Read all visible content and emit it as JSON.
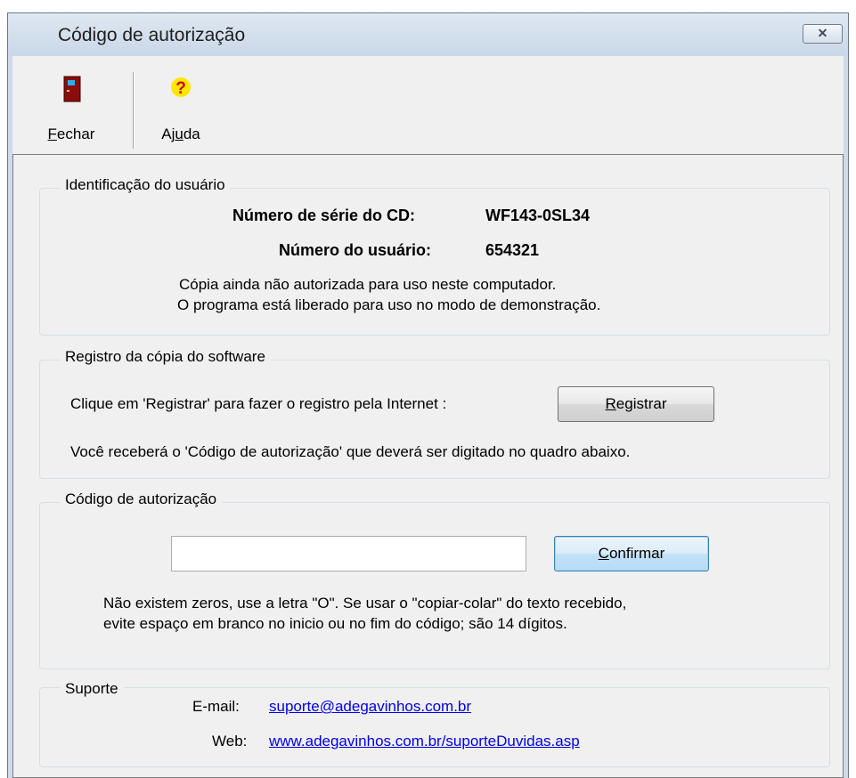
{
  "window": {
    "title": "Código de autorização",
    "close_glyph": "✕"
  },
  "toolbar": {
    "fechar": {
      "label_first": "F",
      "label_rest": "echar",
      "icon": "door-icon"
    },
    "ajuda": {
      "label_first": "Aj",
      "label_mid": "u",
      "label_rest": "da",
      "icon": "help-icon"
    }
  },
  "identificacao": {
    "legend": "Identificação do usuário",
    "serial_label": "Número de série do CD:",
    "serial_value": "WF143-0SL34",
    "user_label": "Número do usuário:",
    "user_value": "654321",
    "status_line1": "Cópia ainda não autorizada para uso neste computador.",
    "status_line2": "O programa está liberado para uso no modo de demonstração."
  },
  "registro": {
    "legend": "Registro da cópia do software",
    "instruction": "Clique em 'Registrar' para fazer o registro pela Internet :",
    "button_first": "R",
    "button_rest": "egistrar",
    "note": "Você receberá o 'Código de autorização' que deverá ser digitado no quadro abaixo."
  },
  "codigo": {
    "legend": "Código de autorização",
    "input_value": "",
    "button_first": "C",
    "button_rest": "onfirmar",
    "hint_line1": "Não existem zeros, use a letra \"O\". Se usar o \"copiar-colar\" do texto recebido,",
    "hint_line2": "evite espaço em branco no inicio ou no fim do código; são 14 dígitos."
  },
  "suporte": {
    "legend": "Suporte",
    "email_label": "E-mail:",
    "email_value": "suporte@adegavinhos.com.br",
    "web_label": "Web:",
    "web_value": "www.adegavinhos.com.br/suporteDuvidas.asp"
  },
  "colors": {
    "link": "#0000ee",
    "panel": "#f0f0f0",
    "titlebar": "#cfdbe9"
  }
}
